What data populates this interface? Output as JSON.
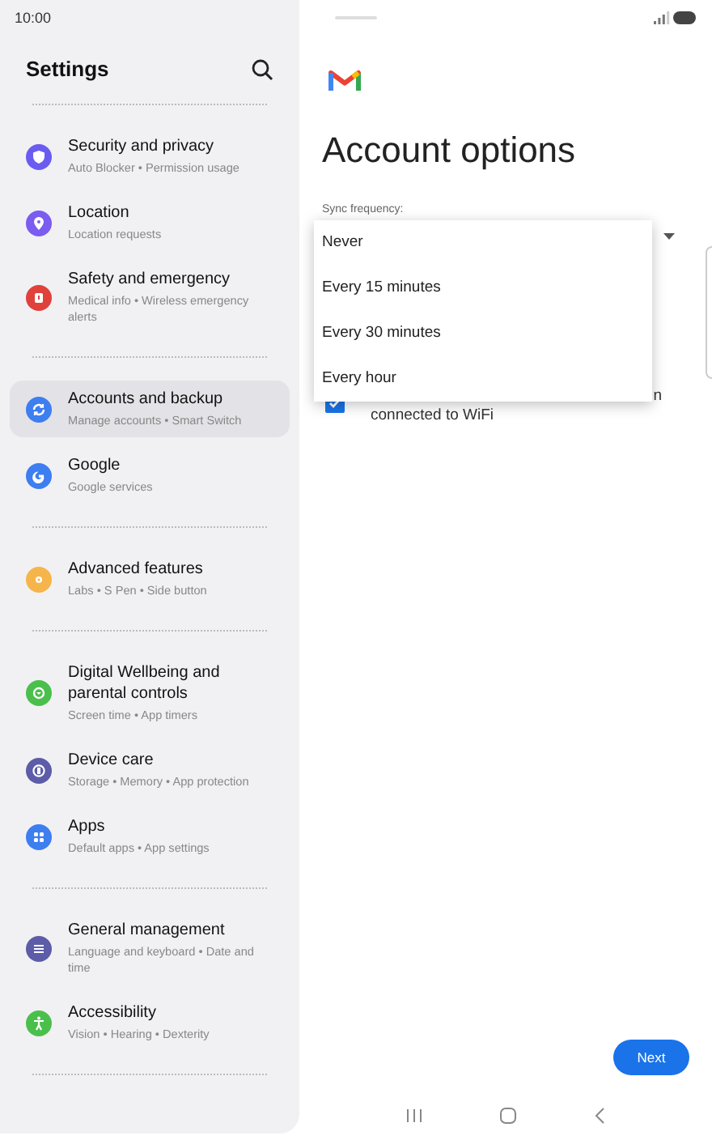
{
  "status_bar": {
    "time": "10:00"
  },
  "sidebar": {
    "title": "Settings",
    "groups": [
      {
        "items": [
          {
            "title": "Security and privacy",
            "subtitle": "Auto Blocker  •  Permission usage",
            "color": "#6a5cf0",
            "selected": false
          },
          {
            "title": "Location",
            "subtitle": "Location requests",
            "color": "#7a5cf0",
            "selected": false
          },
          {
            "title": "Safety and emergency",
            "subtitle": "Medical info  •  Wireless emergency alerts",
            "color": "#e0413a",
            "selected": false
          }
        ]
      },
      {
        "items": [
          {
            "title": "Accounts and backup",
            "subtitle": "Manage accounts  •  Smart Switch",
            "color": "#3d7ef0",
            "selected": true
          },
          {
            "title": "Google",
            "subtitle": "Google services",
            "color": "#3d7ef0",
            "selected": false
          }
        ]
      },
      {
        "items": [
          {
            "title": "Advanced features",
            "subtitle": "Labs  •  S Pen  •  Side button",
            "color": "#f5b54a",
            "selected": false
          }
        ]
      },
      {
        "items": [
          {
            "title": "Digital Wellbeing and parental controls",
            "subtitle": "Screen time  •  App timers",
            "color": "#4bbf4b",
            "selected": false
          },
          {
            "title": "Device care",
            "subtitle": "Storage  •  Memory  •  App protection",
            "color": "#5c5ca8",
            "selected": false
          },
          {
            "title": "Apps",
            "subtitle": "Default apps  •  App settings",
            "color": "#3d7ef0",
            "selected": false
          }
        ]
      },
      {
        "items": [
          {
            "title": "General management",
            "subtitle": "Language and keyboard  •  Date and time",
            "color": "#5c5ca8",
            "selected": false
          },
          {
            "title": "Accessibility",
            "subtitle": "Vision  •  Hearing  •  Dexterity",
            "color": "#4bbf4b",
            "selected": false
          }
        ]
      }
    ]
  },
  "main": {
    "title": "Account options",
    "sync_label": "Sync frequency:",
    "menu": [
      "Never",
      "Every 15 minutes",
      "Every 30 minutes",
      "Every hour"
    ],
    "checkbox": {
      "checked": true,
      "line_1": "n",
      "line_2": "connected to WiFi"
    },
    "next_button": "Next"
  }
}
